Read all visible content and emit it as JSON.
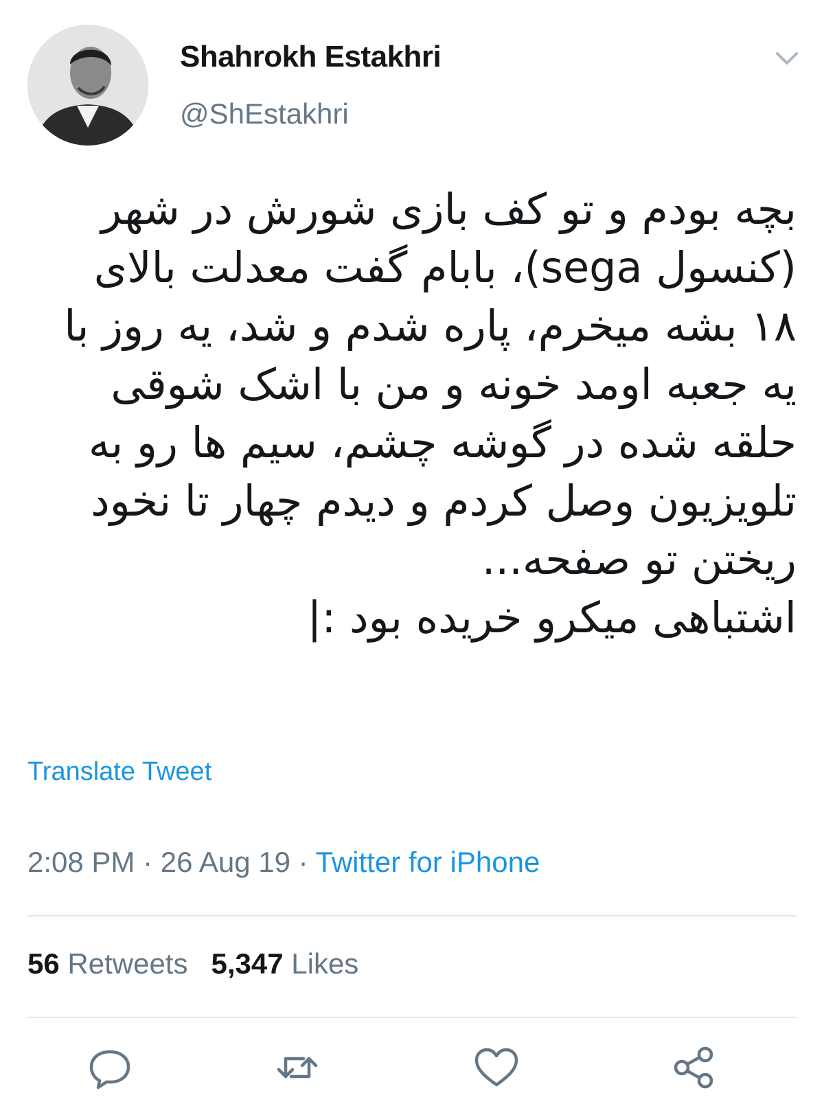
{
  "user": {
    "display_name": "Shahrokh Estakhri",
    "handle": "@ShEstakhri",
    "avatar_icon": "profile-photo"
  },
  "tweet": {
    "lines": [
      "بچه بودم و تو کف بازی شورش در شهر",
      "(کنسول sega)، بابام گفت معدلت بالای",
      "۱۸ بشه میخرم، پاره شدم و شد، یه روز با",
      "یه جعبه اومد خونه و من با اشک شوقی",
      "حلقه شده در گوشه چشم، سیم ها رو به",
      "تلویزیون وصل کردم و دیدم چهار تا نخود",
      "ریختن تو صفحه...",
      "اشتباهی میکرو خریده بود :|"
    ]
  },
  "translate_label": "Translate Tweet",
  "meta": {
    "time": "2:08 PM",
    "separator": " · ",
    "date": "26 Aug 19",
    "source": "Twitter for iPhone"
  },
  "stats": {
    "retweets_count": "56",
    "retweets_label": "Retweets",
    "likes_count": "5,347",
    "likes_label": "Likes"
  },
  "actions": [
    "reply-icon",
    "retweet-icon",
    "like-icon",
    "share-icon"
  ],
  "colors": {
    "link": "#1b95e0",
    "secondary_text": "#657786",
    "primary_text": "#14171a",
    "divider": "#e1e8ed"
  }
}
